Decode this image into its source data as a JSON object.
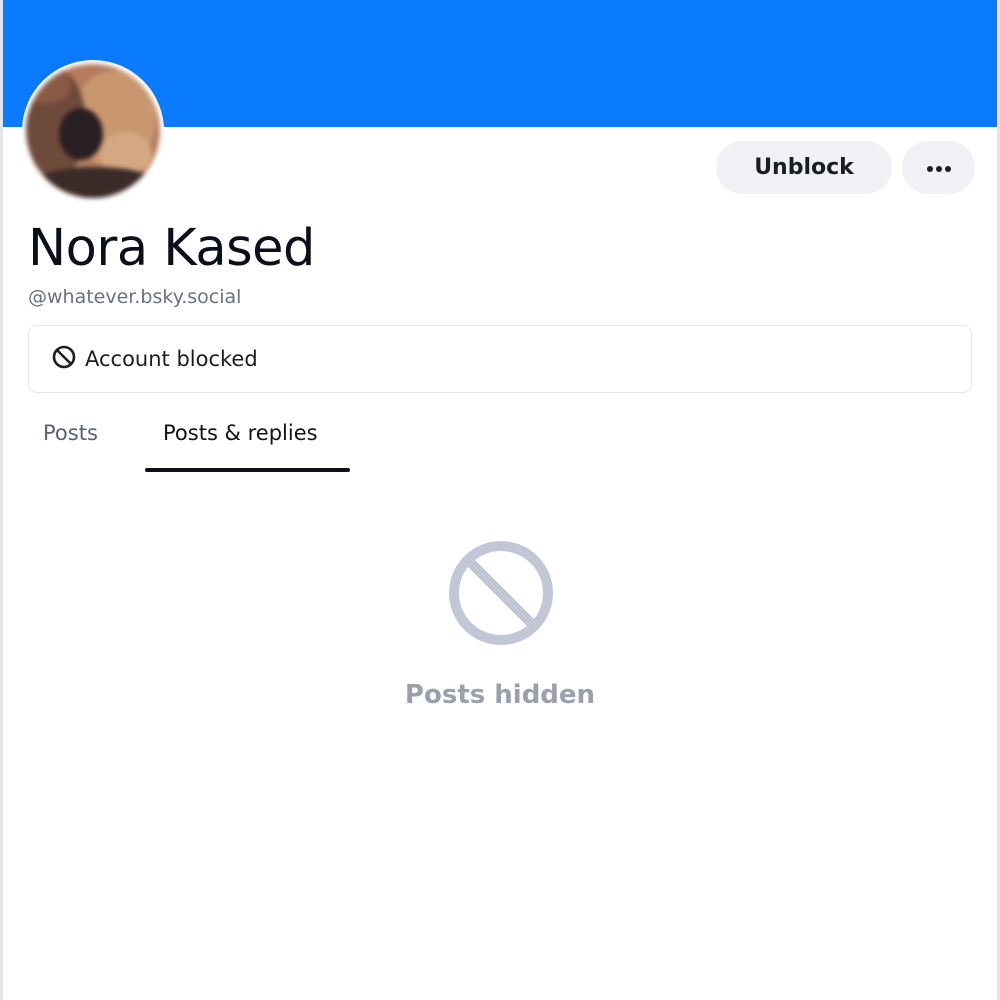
{
  "colors": {
    "banner": "#0A7AFF",
    "icon_muted": "#C2C7D6",
    "button_bg": "#EFF1F5"
  },
  "profile": {
    "display_name": "Nora Kased",
    "handle": "@whatever.bsky.social",
    "avatar_icon": "blurred-profile-photo"
  },
  "actions": {
    "unblock_label": "Unblock",
    "more_icon": "ellipsis-icon"
  },
  "status": {
    "icon": "block-icon",
    "label": "Account blocked"
  },
  "tabs": [
    {
      "label": "Posts",
      "selected": false
    },
    {
      "label": "Posts & replies",
      "selected": true
    }
  ],
  "empty_state": {
    "icon": "block-icon",
    "label": "Posts hidden"
  }
}
